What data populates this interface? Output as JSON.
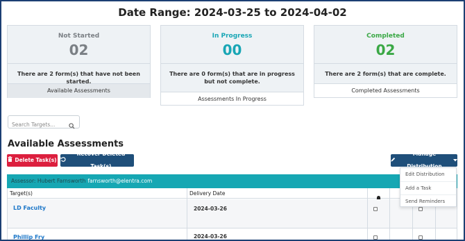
{
  "page": {
    "title": "Date Range: 2024-03-25 to 2024-04-02"
  },
  "cards": [
    {
      "state": "Not Started",
      "count": "02",
      "description": "There are 2 form(s) that have not been started.",
      "footer": "Available Assessments",
      "color": "#7a7f84"
    },
    {
      "state": "In Progress",
      "count": "00",
      "description": "There are 0 form(s) that are in progress but not complete.",
      "footer": "Assessments In Progress",
      "color": "#18a6b5"
    },
    {
      "state": "Completed",
      "count": "02",
      "description": "There are 2 form(s) that are complete.",
      "footer": "Completed Assessments",
      "color": "#3aa845"
    }
  ],
  "search": {
    "placeholder": "Search Targets...",
    "value": ""
  },
  "section": {
    "title": "Available Assessments"
  },
  "buttons": {
    "delete": "Delete Task(s)",
    "recover": "Recover Deleted Task(s)",
    "manage": "Manage Distribution"
  },
  "assessor": {
    "label": "Assessor: Hubert Farnsworth",
    "email": "farnsworth@elentra.com"
  },
  "table": {
    "headers": {
      "target": "Target(s)",
      "delivery": "Delivery Date"
    },
    "rows": [
      {
        "target": "LD Faculty",
        "date": "2024-03-26"
      },
      {
        "target": "Phillip Fry",
        "date": "2024-03-26"
      }
    ]
  },
  "dropdown": {
    "items": [
      "Edit Distribution",
      "Add a Task",
      "Send Reminders"
    ]
  },
  "colors": {
    "accent": "#1f4f7a",
    "danger": "#dc1f3e",
    "teal": "#16a7b3",
    "link": "#1b76c8"
  }
}
